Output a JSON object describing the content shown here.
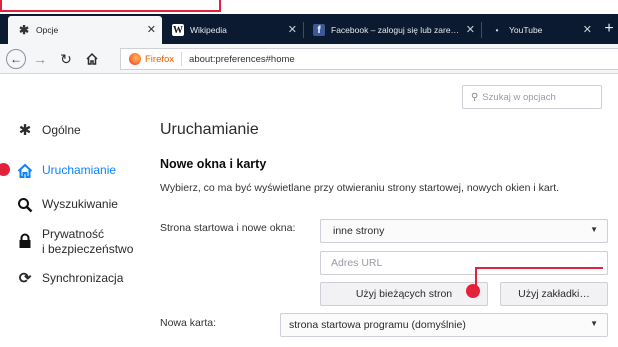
{
  "tabs": [
    {
      "label": "Opcje",
      "icon": "gear-icon",
      "close": "✕"
    },
    {
      "label": "Wikipedia",
      "icon": "wikipedia-icon",
      "close": "✕"
    },
    {
      "label": "Facebook – zaloguj się lub zare…",
      "icon": "facebook-icon",
      "close": "✕"
    },
    {
      "label": "YouTube",
      "icon": "youtube-icon",
      "close": "✕"
    }
  ],
  "new_tab": "+",
  "urlbar": {
    "identity": "Firefox",
    "url": "about:preferences#home"
  },
  "search": {
    "placeholder": "Szukaj w opcjach"
  },
  "sidebar": {
    "items": [
      {
        "label": "Ogólne",
        "icon": "gear-icon"
      },
      {
        "label": "Uruchamianie",
        "icon": "home-icon",
        "selected": true
      },
      {
        "label": "Wyszukiwanie",
        "icon": "search-icon"
      },
      {
        "label": "Prywatność\ni bezpieczeństwo",
        "line1": "Prywatność",
        "line2": "i bezpieczeństwo",
        "icon": "lock-icon"
      },
      {
        "label": "Synchronizacja",
        "icon": "sync-icon"
      }
    ]
  },
  "main": {
    "title": "Uruchamianie",
    "section_title": "Nowe okna i karty",
    "description": "Wybierz, co ma być wyświetlane przy otwieraniu strony startowej, nowych okien i kart.",
    "homepage_label": "Strona startowa i nowe okna:",
    "homepage_value": "inne strony",
    "url_placeholder": "Adres URL",
    "use_current_label": "Użyj bieżących stron",
    "use_bookmark_label": "Użyj zakładki…",
    "newtab_label": "Nowa karta:",
    "newtab_value": "strona startowa programu (domyślnie)"
  },
  "colors": {
    "accent": "#0a84ff",
    "annotation": "#e2213a",
    "tabstrip": "#0b1a30"
  }
}
